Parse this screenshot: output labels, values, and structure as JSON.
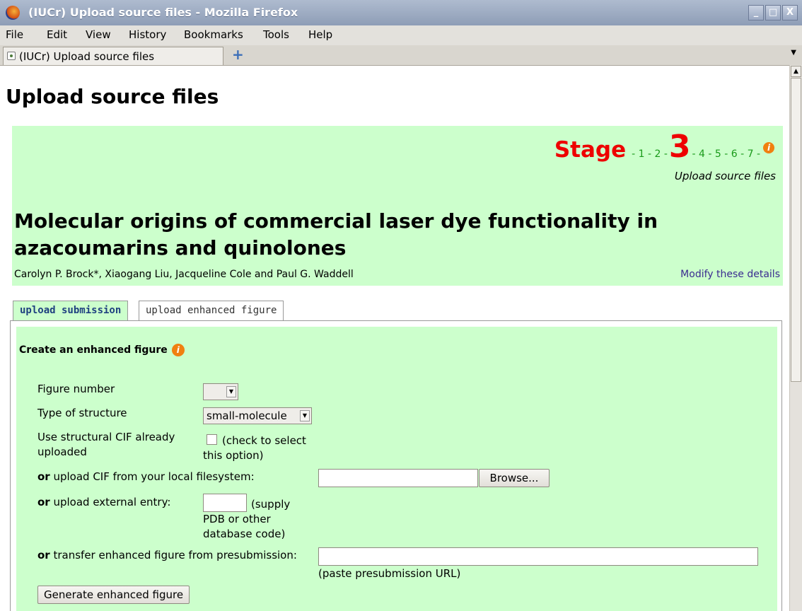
{
  "window": {
    "title": "(IUCr) Upload source files - Mozilla Firefox",
    "buttons": [
      "_",
      "□",
      "X"
    ]
  },
  "menu": {
    "items": [
      "File",
      "Edit",
      "View",
      "History",
      "Bookmarks",
      "Tools",
      "Help"
    ]
  },
  "tabs": {
    "active_label": "(IUCr) Upload source files",
    "new_tab_symbol": "+"
  },
  "page": {
    "heading": "Upload source files",
    "stage": {
      "label": "Stage",
      "before": "- 1 - 2 -",
      "current": "3",
      "after": "- 4 - 5 - 6 - 7 -",
      "info_icon": "i",
      "subtitle": "Upload source files"
    },
    "article": {
      "title": "Molecular origins of commercial laser dye functionality in azacoumarins and quinolones",
      "authors": "Carolyn P. Brock*, Xiaogang Liu, Jacqueline Cole and Paul G. Waddell",
      "modify_link": "Modify these details"
    },
    "subtabs": [
      "upload submission",
      "upload enhanced figure"
    ],
    "form": {
      "heading": "Create an enhanced figure",
      "info_icon": "i",
      "figure_number_label": "Figure number",
      "figure_number_value": "",
      "structure_type_label": "Type of structure",
      "structure_type_value": "small-molecule",
      "use_cif_label": "Use structural CIF already uploaded",
      "use_cif_hint": "(check to select this option)",
      "or": "or",
      "upload_cif_label": " upload CIF from your local filesystem:",
      "browse_button": "Browse...",
      "external_label": " upload external entry:",
      "external_hint": "(supply PDB or other database code)",
      "transfer_label": " transfer enhanced figure from presubmission:",
      "transfer_hint": "(paste presubmission URL)",
      "generate_button": "Generate enhanced figure"
    }
  }
}
